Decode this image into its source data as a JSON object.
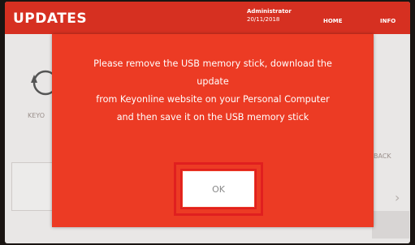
{
  "header": {
    "title": "UPDATES",
    "user_role": "Administrator",
    "date": "20/11/2018",
    "nav_home": "HOME",
    "nav_info": "INFO"
  },
  "background": {
    "keyo_label": "KEYO",
    "back_label": "BACK"
  },
  "dialog": {
    "message_lines": [
      "Please remove the USB memory stick, download the",
      "update",
      "from Keyonline website on your Personal Computer",
      "and then save it on the USB memory stick"
    ],
    "ok_label": "OK"
  },
  "colors": {
    "header": "#d63021",
    "dialog": "#ec3b24",
    "highlight": "#e01f1f"
  }
}
